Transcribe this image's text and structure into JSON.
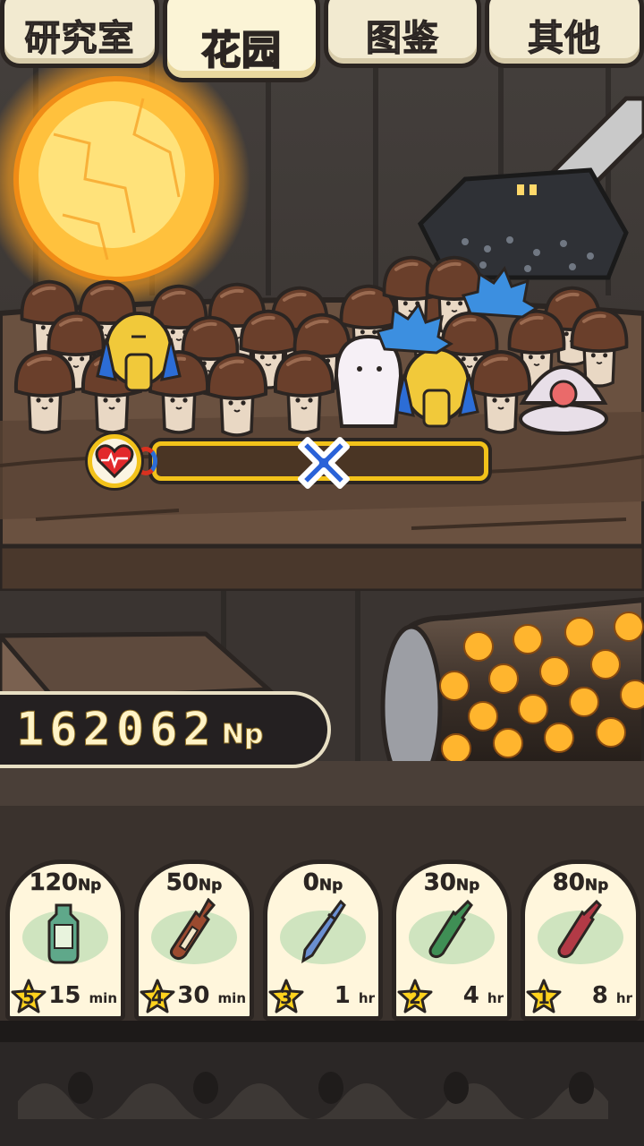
{
  "tabs": [
    {
      "label": "研究室",
      "active": false
    },
    {
      "label": "花园",
      "active": true
    },
    {
      "label": "图鉴",
      "active": false
    },
    {
      "label": "其他",
      "active": false
    }
  ],
  "money": {
    "value": "162062",
    "unit": "Np"
  },
  "gauge": {
    "icon": "heart-icon",
    "state_icon": "x-mark-icon",
    "level": 0.5
  },
  "items": [
    {
      "cost": "120",
      "cost_unit": "Np",
      "level": "5",
      "time": "15",
      "time_unit": "min",
      "icon": "bottle-icon",
      "color": "#5fa88a"
    },
    {
      "cost": "50",
      "cost_unit": "Np",
      "level": "4",
      "time": "30",
      "time_unit": "min",
      "icon": "tall-bottle-icon",
      "color": "#9b4a2f"
    },
    {
      "cost": "0",
      "cost_unit": "Np",
      "level": "3",
      "time": "1",
      "time_unit": "hr",
      "icon": "pen-icon",
      "color": "#6a8fd1"
    },
    {
      "cost": "30",
      "cost_unit": "Np",
      "level": "2",
      "time": "4",
      "time_unit": "hr",
      "icon": "vial-icon",
      "color": "#3f8f55"
    },
    {
      "cost": "80",
      "cost_unit": "Np",
      "level": "1",
      "time": "8",
      "time_unit": "hr",
      "icon": "ampoule-icon",
      "color": "#b23a46"
    }
  ],
  "colors": {
    "accent": "#f2c21a",
    "tab_active_text": "#ffd21d",
    "dark": "#2b2522"
  }
}
